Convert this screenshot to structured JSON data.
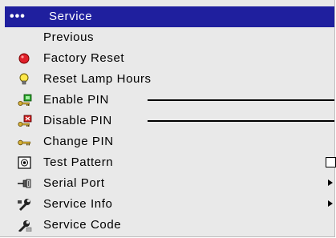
{
  "menu": {
    "title": "Service",
    "dots": "•••",
    "items": [
      {
        "label": "Previous",
        "icon": ""
      },
      {
        "label": "Factory Reset",
        "icon": "red-circle-icon"
      },
      {
        "label": "Reset Lamp Hours",
        "icon": "lightbulb-icon"
      },
      {
        "label": "Enable PIN",
        "icon": "key-enable-icon"
      },
      {
        "label": "Disable PIN",
        "icon": "key-disable-icon"
      },
      {
        "label": "Change PIN",
        "icon": "key-icon"
      },
      {
        "label": "Test Pattern",
        "icon": "test-pattern-icon"
      },
      {
        "label": "Serial Port",
        "icon": "serial-port-icon"
      },
      {
        "label": "Service Info",
        "icon": "wrench-icon"
      },
      {
        "label": "Service Code",
        "icon": "wrench-code-icon"
      }
    ]
  },
  "colors": {
    "titlebar": "#1f1f9e",
    "menu_background": "#e9e9e9"
  }
}
